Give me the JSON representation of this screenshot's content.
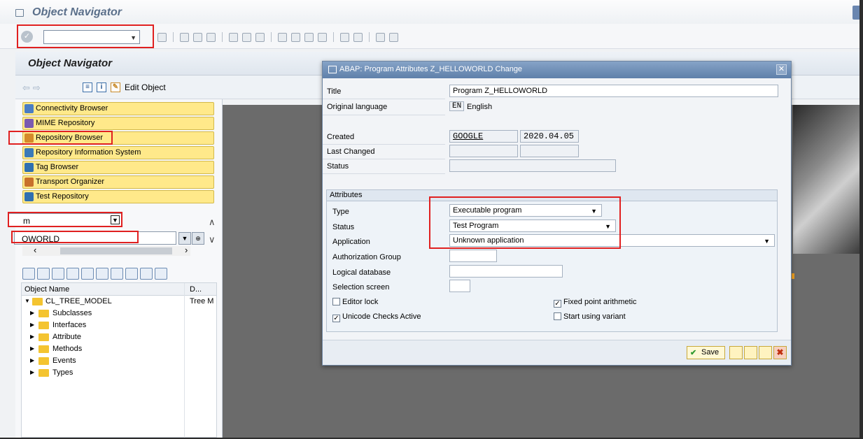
{
  "window": {
    "title": "Object Navigator"
  },
  "toolbar": {
    "command_value": ""
  },
  "header": {
    "title": "Object Navigator",
    "edit_object": "Edit Object"
  },
  "browsers": [
    {
      "label": "Connectivity Browser",
      "color": "#4a7dc4"
    },
    {
      "label": "MIME Repository",
      "color": "#7a5ab0"
    },
    {
      "label": "Repository Browser",
      "color": "#d48a2a"
    },
    {
      "label": "Repository Information System",
      "color": "#3a7ab8"
    },
    {
      "label": "Tag Browser",
      "color": "#2f6fb0"
    },
    {
      "label": "Transport Organizer",
      "color": "#c8702a"
    },
    {
      "label": "Test Repository",
      "color": "#2f6fb0"
    }
  ],
  "object_type_select": {
    "value": "m"
  },
  "object_name_input": {
    "value": "OWORLD"
  },
  "tree": {
    "columns": [
      "Object Name",
      "D..."
    ],
    "root": {
      "name": "CL_TREE_MODEL",
      "description": "Tree M"
    },
    "children": [
      "Subclasses",
      "Interfaces",
      "Attribute",
      "Methods",
      "Events",
      "Types"
    ]
  },
  "dialog": {
    "title": "ABAP: Program Attributes Z_HELLOWORLD Change",
    "labels": {
      "title": "Title",
      "original_language": "Original language",
      "created": "Created",
      "last_changed": "Last Changed",
      "status": "Status"
    },
    "title_value": "Program Z_HELLOWORLD",
    "lang_code": "EN",
    "lang_name": "English",
    "created_by": "GOOGLE",
    "created_on": "2020.04.05",
    "attributes": {
      "header": "Attributes",
      "type_label": "Type",
      "type_value": "Executable program",
      "status_label": "Status",
      "status_value": "Test Program",
      "application_label": "Application",
      "application_value": "Unknown application",
      "auth_group_label": "Authorization Group",
      "logical_db_label": "Logical database",
      "selection_screen_label": "Selection screen",
      "editor_lock": "Editor lock",
      "unicode_checks": "Unicode Checks Active",
      "fixed_point": "Fixed point arithmetic",
      "start_variant": "Start using variant"
    },
    "save_label": "Save"
  }
}
